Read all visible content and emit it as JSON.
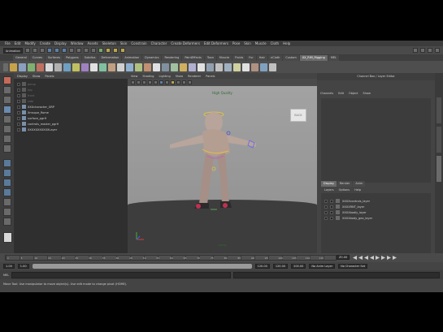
{
  "menubar": [
    "File",
    "Edit",
    "Modify",
    "Create",
    "Display",
    "Window",
    "Assets",
    "Skeleton",
    "Skin",
    "Constrain",
    "Character",
    "Create Deformers",
    "Edit Deformers",
    "Pose",
    "Skin",
    "Muscle",
    "Cloth",
    "Help"
  ],
  "statusline": {
    "menu_set": "Animation"
  },
  "shelf_tabs": [
    "General",
    "Curves",
    "Surfaces",
    "Polygons",
    "Subdivs",
    "Deformation",
    "Animation",
    "Dynamics",
    "Rendering",
    "PaintEffects",
    "Toon",
    "Muscle",
    "Fluids",
    "Fur",
    "Hair",
    "nCloth",
    "Custom",
    "XX_RIM_Rigging",
    "MEL"
  ],
  "shelf_active": "XX_RIM_Rigging",
  "outliner": {
    "menu": [
      "Display",
      "Show",
      "Panels"
    ],
    "items": [
      {
        "label": "persp",
        "dim": true
      },
      {
        "label": "top",
        "dim": true
      },
      {
        "label": "front",
        "dim": true
      },
      {
        "label": "side",
        "dim": true
      },
      {
        "label": "XXXcharacter_GRP",
        "dim": false
      },
      {
        "label": "Xmsque_Rome",
        "dim": false
      },
      {
        "label": "surface_pgrH",
        "dim": false
      },
      {
        "label": "controls_master_pgrH",
        "dim": false
      },
      {
        "label": "XXXXXXXXXXXLayer",
        "dim": false
      }
    ]
  },
  "viewport": {
    "menu": [
      "View",
      "Shading",
      "Lighting",
      "Show",
      "Renderer",
      "Panels"
    ],
    "label": "High Quality",
    "viewcube": "BACK",
    "bottom_label": "persp"
  },
  "channel_box": {
    "title": "Channel Box / Layer Editor",
    "menu": [
      "Channels",
      "Edit",
      "Object",
      "Show"
    ],
    "layer_tabs": [
      "Display",
      "Render",
      "Anim"
    ],
    "layer_menu": [
      "Layers",
      "Options",
      "Help"
    ],
    "layers": [
      "XXXXcontrols_layer",
      "XXXXRNT_layer",
      "XXXXbodiy_layer",
      "XXXXbody_geo_layer"
    ]
  },
  "timeslider": {
    "ticks": [
      "1",
      "5",
      "10",
      "15",
      "20",
      "25",
      "30",
      "35",
      "40",
      "45",
      "50",
      "55",
      "60",
      "65",
      "70",
      "75",
      "80",
      "85",
      "90",
      "95",
      "100",
      "105",
      "110",
      "115"
    ],
    "current_frame": "Z0.00"
  },
  "range": {
    "start": "1.00",
    "inner_start": "1.00",
    "inner_end": "120.00",
    "end": "120.00",
    "end2": "200.00",
    "anim_layer": "No Anim Layer",
    "char_set": "No Character Set"
  },
  "cmdline": {
    "label": "MEL"
  },
  "helpline": "Move Tool: Use manipulator to move object(s). Use edit mode to change pivot (HOME)."
}
